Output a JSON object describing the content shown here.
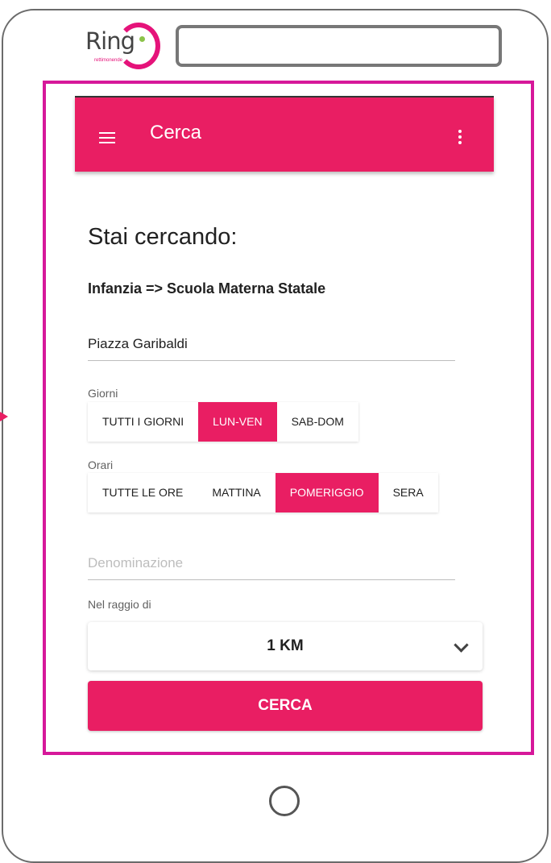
{
  "logo": {
    "text": "Ring",
    "tagline": "rettimonende"
  },
  "appbar": {
    "title": "Cerca",
    "menu_icon": "menu-icon",
    "more_icon": "more-vert-icon",
    "color": "#e91e63"
  },
  "search": {
    "heading": "Stai cercando:",
    "category": "Infanzia => Scuola Materna Statale",
    "address": "Piazza Garibaldi",
    "name_placeholder": "Denominazione"
  },
  "giorni": {
    "label": "Giorni",
    "options": [
      "TUTTI I GIORNI",
      "LUN-VEN",
      "SAB-DOM"
    ],
    "selected": "LUN-VEN"
  },
  "orari": {
    "label": "Orari",
    "options": [
      "TUTTE LE ORE",
      "MATTINA",
      "POMERIGGIO",
      "SERA"
    ],
    "selected": "POMERIGGIO"
  },
  "radius": {
    "label": "Nel raggio di",
    "value": "1 KM"
  },
  "submit_label": "CERCA",
  "accent_color": "#e91e63",
  "frame_color": "#d6189a"
}
